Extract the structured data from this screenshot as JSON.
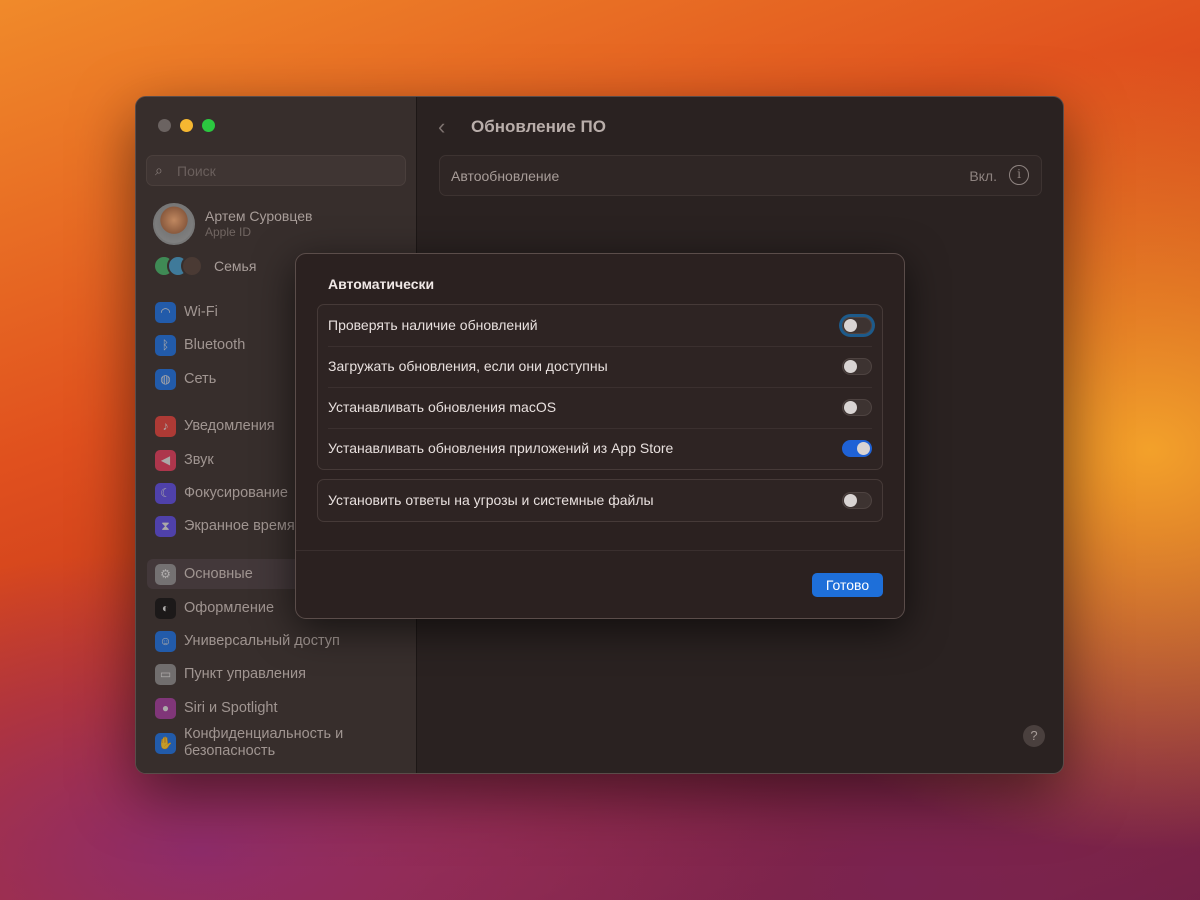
{
  "sidebar": {
    "search_placeholder": "Поиск",
    "user": {
      "name": "Артем Суровцев",
      "subtitle": "Apple ID"
    },
    "family_label": "Семья",
    "items": [
      {
        "label": "Wi-Fi",
        "icon": "wifi-icon",
        "color": "#1a6fe0"
      },
      {
        "label": "Bluetooth",
        "icon": "bluetooth-icon",
        "color": "#1a6fe0"
      },
      {
        "label": "Сеть",
        "icon": "globe-icon",
        "color": "#1a6fe0"
      },
      {
        "label": "Уведомления",
        "icon": "bell-icon",
        "color": "#e0403a"
      },
      {
        "label": "Звук",
        "icon": "speaker-icon",
        "color": "#e03a5a"
      },
      {
        "label": "Фокусирование",
        "icon": "moon-icon",
        "color": "#5a4ae0"
      },
      {
        "label": "Экранное время",
        "icon": "hourglass-icon",
        "color": "#5a4ae0"
      },
      {
        "label": "Основные",
        "icon": "gear-icon",
        "color": "#8a8a8a"
      },
      {
        "label": "Оформление",
        "icon": "appearance-icon",
        "color": "#111111"
      },
      {
        "label": "Универсальный доступ",
        "icon": "accessibility-icon",
        "color": "#1a6fe0"
      },
      {
        "label": "Пункт управления",
        "icon": "control-center-icon",
        "color": "#8a8a8a"
      },
      {
        "label": "Siri и Spotlight",
        "icon": "siri-icon",
        "color": "#a03a9a"
      },
      {
        "label": "Конфиденциальность и безопасность",
        "icon": "hand-icon",
        "color": "#1a6fe0"
      }
    ]
  },
  "main": {
    "title": "Обновление ПО",
    "auto_update_label": "Автообновление",
    "auto_update_value": "Вкл.",
    "help": "?"
  },
  "dialog": {
    "title": "Автоматически",
    "group1": [
      {
        "label": "Проверять наличие обновлений",
        "on": false
      },
      {
        "label": "Загружать обновления, если они доступны",
        "on": false
      },
      {
        "label": "Устанавливать обновления macOS",
        "on": false
      },
      {
        "label": "Устанавливать обновления приложений из App Store",
        "on": true
      }
    ],
    "group2": [
      {
        "label": "Установить ответы на угрозы и системные файлы",
        "on": false
      }
    ],
    "done_label": "Готово"
  }
}
